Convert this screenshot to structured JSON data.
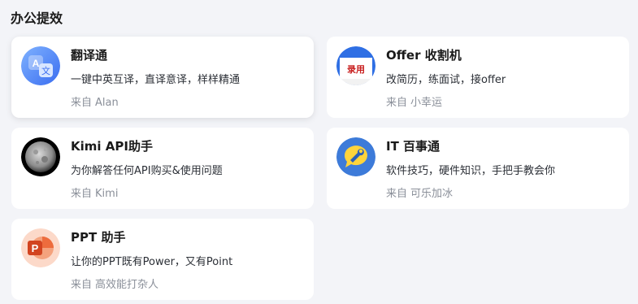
{
  "section": {
    "title": "办公提效"
  },
  "by_label": "来自",
  "bots": [
    {
      "name": "翻译通",
      "description": "一键中英互译，直译意译，样样精通",
      "author": "Alan",
      "icon": "translate-icon"
    },
    {
      "name": "Offer 收割机",
      "description": "改简历，练面试，接offer",
      "author": "小幸运",
      "icon": "offer-hire-icon",
      "stamp": "录用"
    },
    {
      "name": "Kimi API助手",
      "description": "为你解答任何API购买&使用问题",
      "author": "Kimi",
      "icon": "moon-icon"
    },
    {
      "name": "IT 百事通",
      "description": "软件技巧，硬件知识，手把手教会你",
      "author": "可乐加冰",
      "icon": "wrench-chat-icon"
    },
    {
      "name": "PPT 助手",
      "description": "让你的PPT既有Power，又有Point",
      "author": "高效能打杂人",
      "icon": "powerpoint-icon"
    }
  ],
  "colors": {
    "background": "#f3f4f8",
    "card": "#ffffff",
    "muted_text": "#8a8f99"
  }
}
